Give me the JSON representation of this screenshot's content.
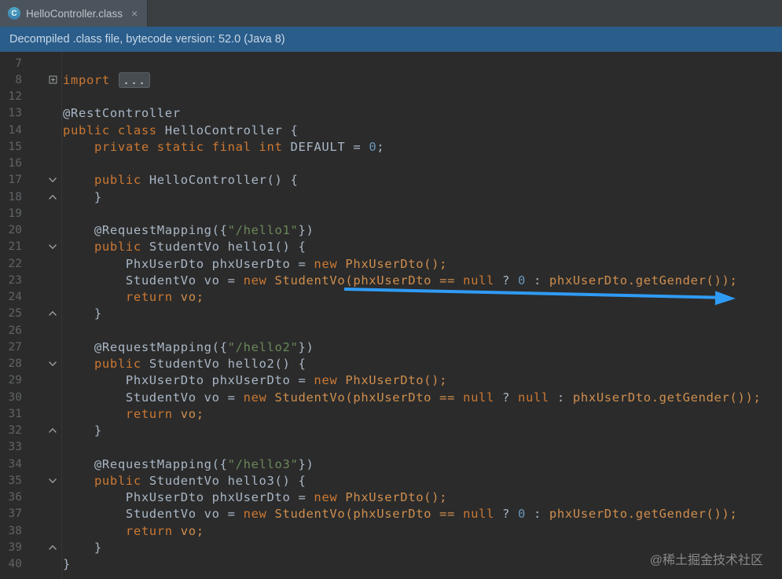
{
  "tab": {
    "title": "HelloController.class",
    "close": "×",
    "icon_letter": "C"
  },
  "banner": {
    "text": "Decompiled .class file, bytecode version: 52.0 (Java 8)"
  },
  "overlay": {
    "watermark": "@稀土掘金技术社区"
  },
  "icons": {
    "tab_file": "class-icon",
    "tab_close": "close-icon",
    "fold_collapsed": "plus-box-icon",
    "fold_start": "chevron-down-icon",
    "fold_end": "chevron-up-icon"
  },
  "colors": {
    "editor_bg": "#2b2b2b",
    "tabbar_bg": "#3c3f41",
    "active_tab_bg": "#4b545c",
    "banner_bg": "#2b5d8b",
    "keyword": "#cc7832",
    "plain": "#a9b7c6",
    "number": "#6897bb",
    "string": "#6a8759",
    "call": "#cf8e4e",
    "line_number": "#606366",
    "arrow": "#2f9bf5"
  },
  "editor": {
    "lines": [
      {
        "num": "7",
        "tokens": []
      },
      {
        "num": "8",
        "icon": "box",
        "tokens": [
          {
            "t": "import ",
            "c": "kw"
          },
          {
            "t": "...",
            "c": "fold"
          }
        ]
      },
      {
        "num": "12",
        "tokens": []
      },
      {
        "num": "13",
        "tokens": [
          {
            "t": "@RestController",
            "c": "pl"
          }
        ]
      },
      {
        "num": "14",
        "tokens": [
          {
            "t": "public class ",
            "c": "kw"
          },
          {
            "t": "HelloController {",
            "c": "pl"
          }
        ]
      },
      {
        "num": "15",
        "tokens": [
          {
            "t": "    ",
            "c": "pl"
          },
          {
            "t": "private static final int ",
            "c": "kw"
          },
          {
            "t": "DEFAULT = ",
            "c": "pl"
          },
          {
            "t": "0",
            "c": "num"
          },
          {
            "t": ";",
            "c": "pl"
          }
        ]
      },
      {
        "num": "16",
        "tokens": []
      },
      {
        "num": "17",
        "icon": "down",
        "tokens": [
          {
            "t": "    ",
            "c": "pl"
          },
          {
            "t": "public ",
            "c": "kw"
          },
          {
            "t": "HelloController() {",
            "c": "pl"
          }
        ]
      },
      {
        "num": "18",
        "icon": "up",
        "tokens": [
          {
            "t": "    }",
            "c": "pl"
          }
        ]
      },
      {
        "num": "19",
        "tokens": []
      },
      {
        "num": "20",
        "tokens": [
          {
            "t": "    @RequestMapping({",
            "c": "pl"
          },
          {
            "t": "\"/hello1\"",
            "c": "str"
          },
          {
            "t": "})",
            "c": "pl"
          }
        ]
      },
      {
        "num": "21",
        "icon": "down",
        "tokens": [
          {
            "t": "    ",
            "c": "pl"
          },
          {
            "t": "public ",
            "c": "kw"
          },
          {
            "t": "StudentVo hello1() {",
            "c": "pl"
          }
        ]
      },
      {
        "num": "22",
        "tokens": [
          {
            "t": "        PhxUserDto phxUserDto = ",
            "c": "pl"
          },
          {
            "t": "new",
            "c": "kw"
          },
          {
            "t": " PhxUserDto();",
            "c": "call"
          }
        ]
      },
      {
        "num": "23",
        "tokens": [
          {
            "t": "        StudentVo vo = ",
            "c": "pl"
          },
          {
            "t": "new",
            "c": "kw"
          },
          {
            "t": " StudentVo(phxUserDto == ",
            "c": "call"
          },
          {
            "t": "null",
            "c": "kw"
          },
          {
            "t": " ? ",
            "c": "pl"
          },
          {
            "t": "0",
            "c": "num"
          },
          {
            "t": " : ",
            "c": "pl"
          },
          {
            "t": "phxUserDto.getGender());",
            "c": "call"
          }
        ]
      },
      {
        "num": "24",
        "tokens": [
          {
            "t": "        ",
            "c": "pl"
          },
          {
            "t": "return",
            "c": "kw"
          },
          {
            "t": " vo;",
            "c": "call"
          }
        ]
      },
      {
        "num": "25",
        "icon": "up",
        "tokens": [
          {
            "t": "    }",
            "c": "pl"
          }
        ]
      },
      {
        "num": "26",
        "tokens": []
      },
      {
        "num": "27",
        "tokens": [
          {
            "t": "    @RequestMapping({",
            "c": "pl"
          },
          {
            "t": "\"/hello2\"",
            "c": "str"
          },
          {
            "t": "})",
            "c": "pl"
          }
        ]
      },
      {
        "num": "28",
        "icon": "down",
        "tokens": [
          {
            "t": "    ",
            "c": "pl"
          },
          {
            "t": "public ",
            "c": "kw"
          },
          {
            "t": "StudentVo hello2() {",
            "c": "pl"
          }
        ]
      },
      {
        "num": "29",
        "tokens": [
          {
            "t": "        PhxUserDto phxUserDto = ",
            "c": "pl"
          },
          {
            "t": "new",
            "c": "kw"
          },
          {
            "t": " PhxUserDto();",
            "c": "call"
          }
        ]
      },
      {
        "num": "30",
        "tokens": [
          {
            "t": "        StudentVo vo = ",
            "c": "pl"
          },
          {
            "t": "new",
            "c": "kw"
          },
          {
            "t": " StudentVo(phxUserDto == ",
            "c": "call"
          },
          {
            "t": "null",
            "c": "kw"
          },
          {
            "t": " ? ",
            "c": "pl"
          },
          {
            "t": "null",
            "c": "kw"
          },
          {
            "t": " : ",
            "c": "pl"
          },
          {
            "t": "phxUserDto.getGender());",
            "c": "call"
          }
        ]
      },
      {
        "num": "31",
        "tokens": [
          {
            "t": "        ",
            "c": "pl"
          },
          {
            "t": "return",
            "c": "kw"
          },
          {
            "t": " vo;",
            "c": "call"
          }
        ]
      },
      {
        "num": "32",
        "icon": "up",
        "tokens": [
          {
            "t": "    }",
            "c": "pl"
          }
        ]
      },
      {
        "num": "33",
        "tokens": []
      },
      {
        "num": "34",
        "tokens": [
          {
            "t": "    @RequestMapping({",
            "c": "pl"
          },
          {
            "t": "\"/hello3\"",
            "c": "str"
          },
          {
            "t": "})",
            "c": "pl"
          }
        ]
      },
      {
        "num": "35",
        "icon": "down",
        "tokens": [
          {
            "t": "    ",
            "c": "pl"
          },
          {
            "t": "public ",
            "c": "kw"
          },
          {
            "t": "StudentVo hello3() {",
            "c": "pl"
          }
        ]
      },
      {
        "num": "36",
        "tokens": [
          {
            "t": "        PhxUserDto phxUserDto = ",
            "c": "pl"
          },
          {
            "t": "new",
            "c": "kw"
          },
          {
            "t": " PhxUserDto();",
            "c": "call"
          }
        ]
      },
      {
        "num": "37",
        "tokens": [
          {
            "t": "        StudentVo vo = ",
            "c": "pl"
          },
          {
            "t": "new",
            "c": "kw"
          },
          {
            "t": " StudentVo(phxUserDto == ",
            "c": "call"
          },
          {
            "t": "null",
            "c": "kw"
          },
          {
            "t": " ? ",
            "c": "pl"
          },
          {
            "t": "0",
            "c": "num"
          },
          {
            "t": " : ",
            "c": "pl"
          },
          {
            "t": "phxUserDto.getGender());",
            "c": "call"
          }
        ]
      },
      {
        "num": "38",
        "tokens": [
          {
            "t": "        ",
            "c": "pl"
          },
          {
            "t": "return",
            "c": "kw"
          },
          {
            "t": " vo;",
            "c": "call"
          }
        ]
      },
      {
        "num": "39",
        "icon": "up",
        "tokens": [
          {
            "t": "    }",
            "c": "pl"
          }
        ]
      },
      {
        "num": "40",
        "tokens": [
          {
            "t": "}",
            "c": "pl"
          }
        ]
      }
    ]
  }
}
